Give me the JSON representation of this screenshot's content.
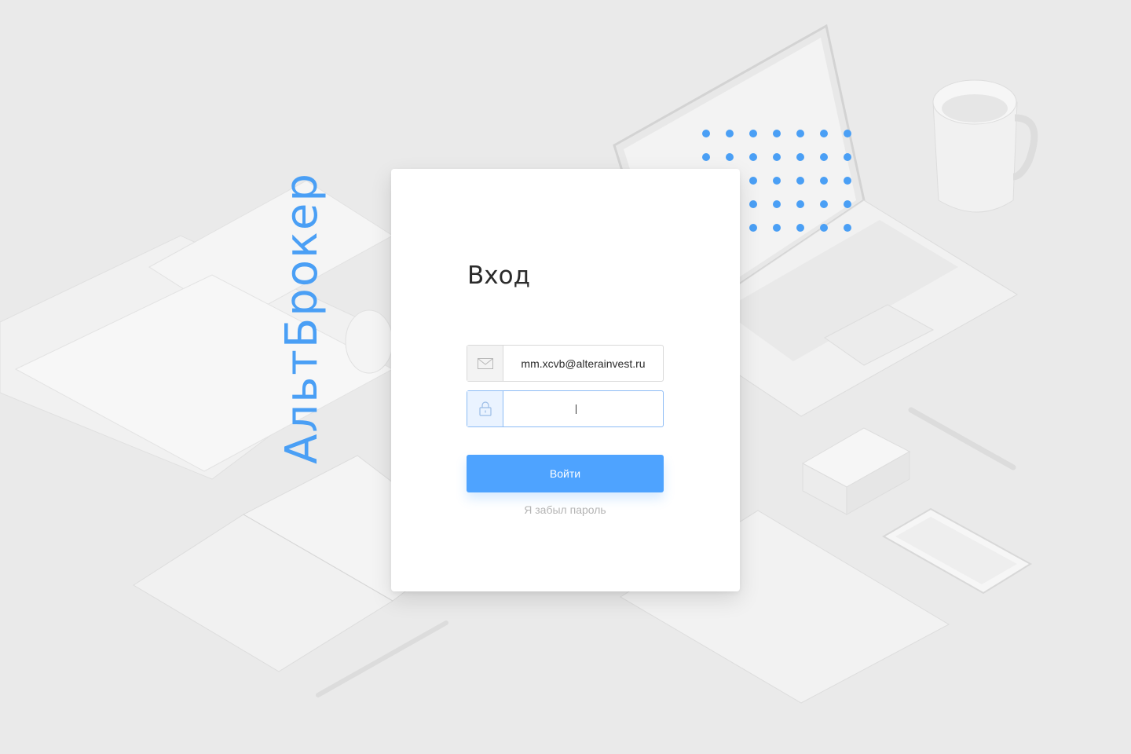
{
  "brand": {
    "name": "АльтБрокер",
    "accent_color": "#4a9ff5"
  },
  "login_form": {
    "title": "Вход",
    "email": {
      "value": "mm.xcvb@alterainvest.ru",
      "icon": "mail-icon"
    },
    "password": {
      "value": "",
      "icon": "lock-icon",
      "focused": true
    },
    "submit_label": "Войти",
    "forgot_label": "Я забыл пароль",
    "button_color": "#4ea3ff"
  }
}
